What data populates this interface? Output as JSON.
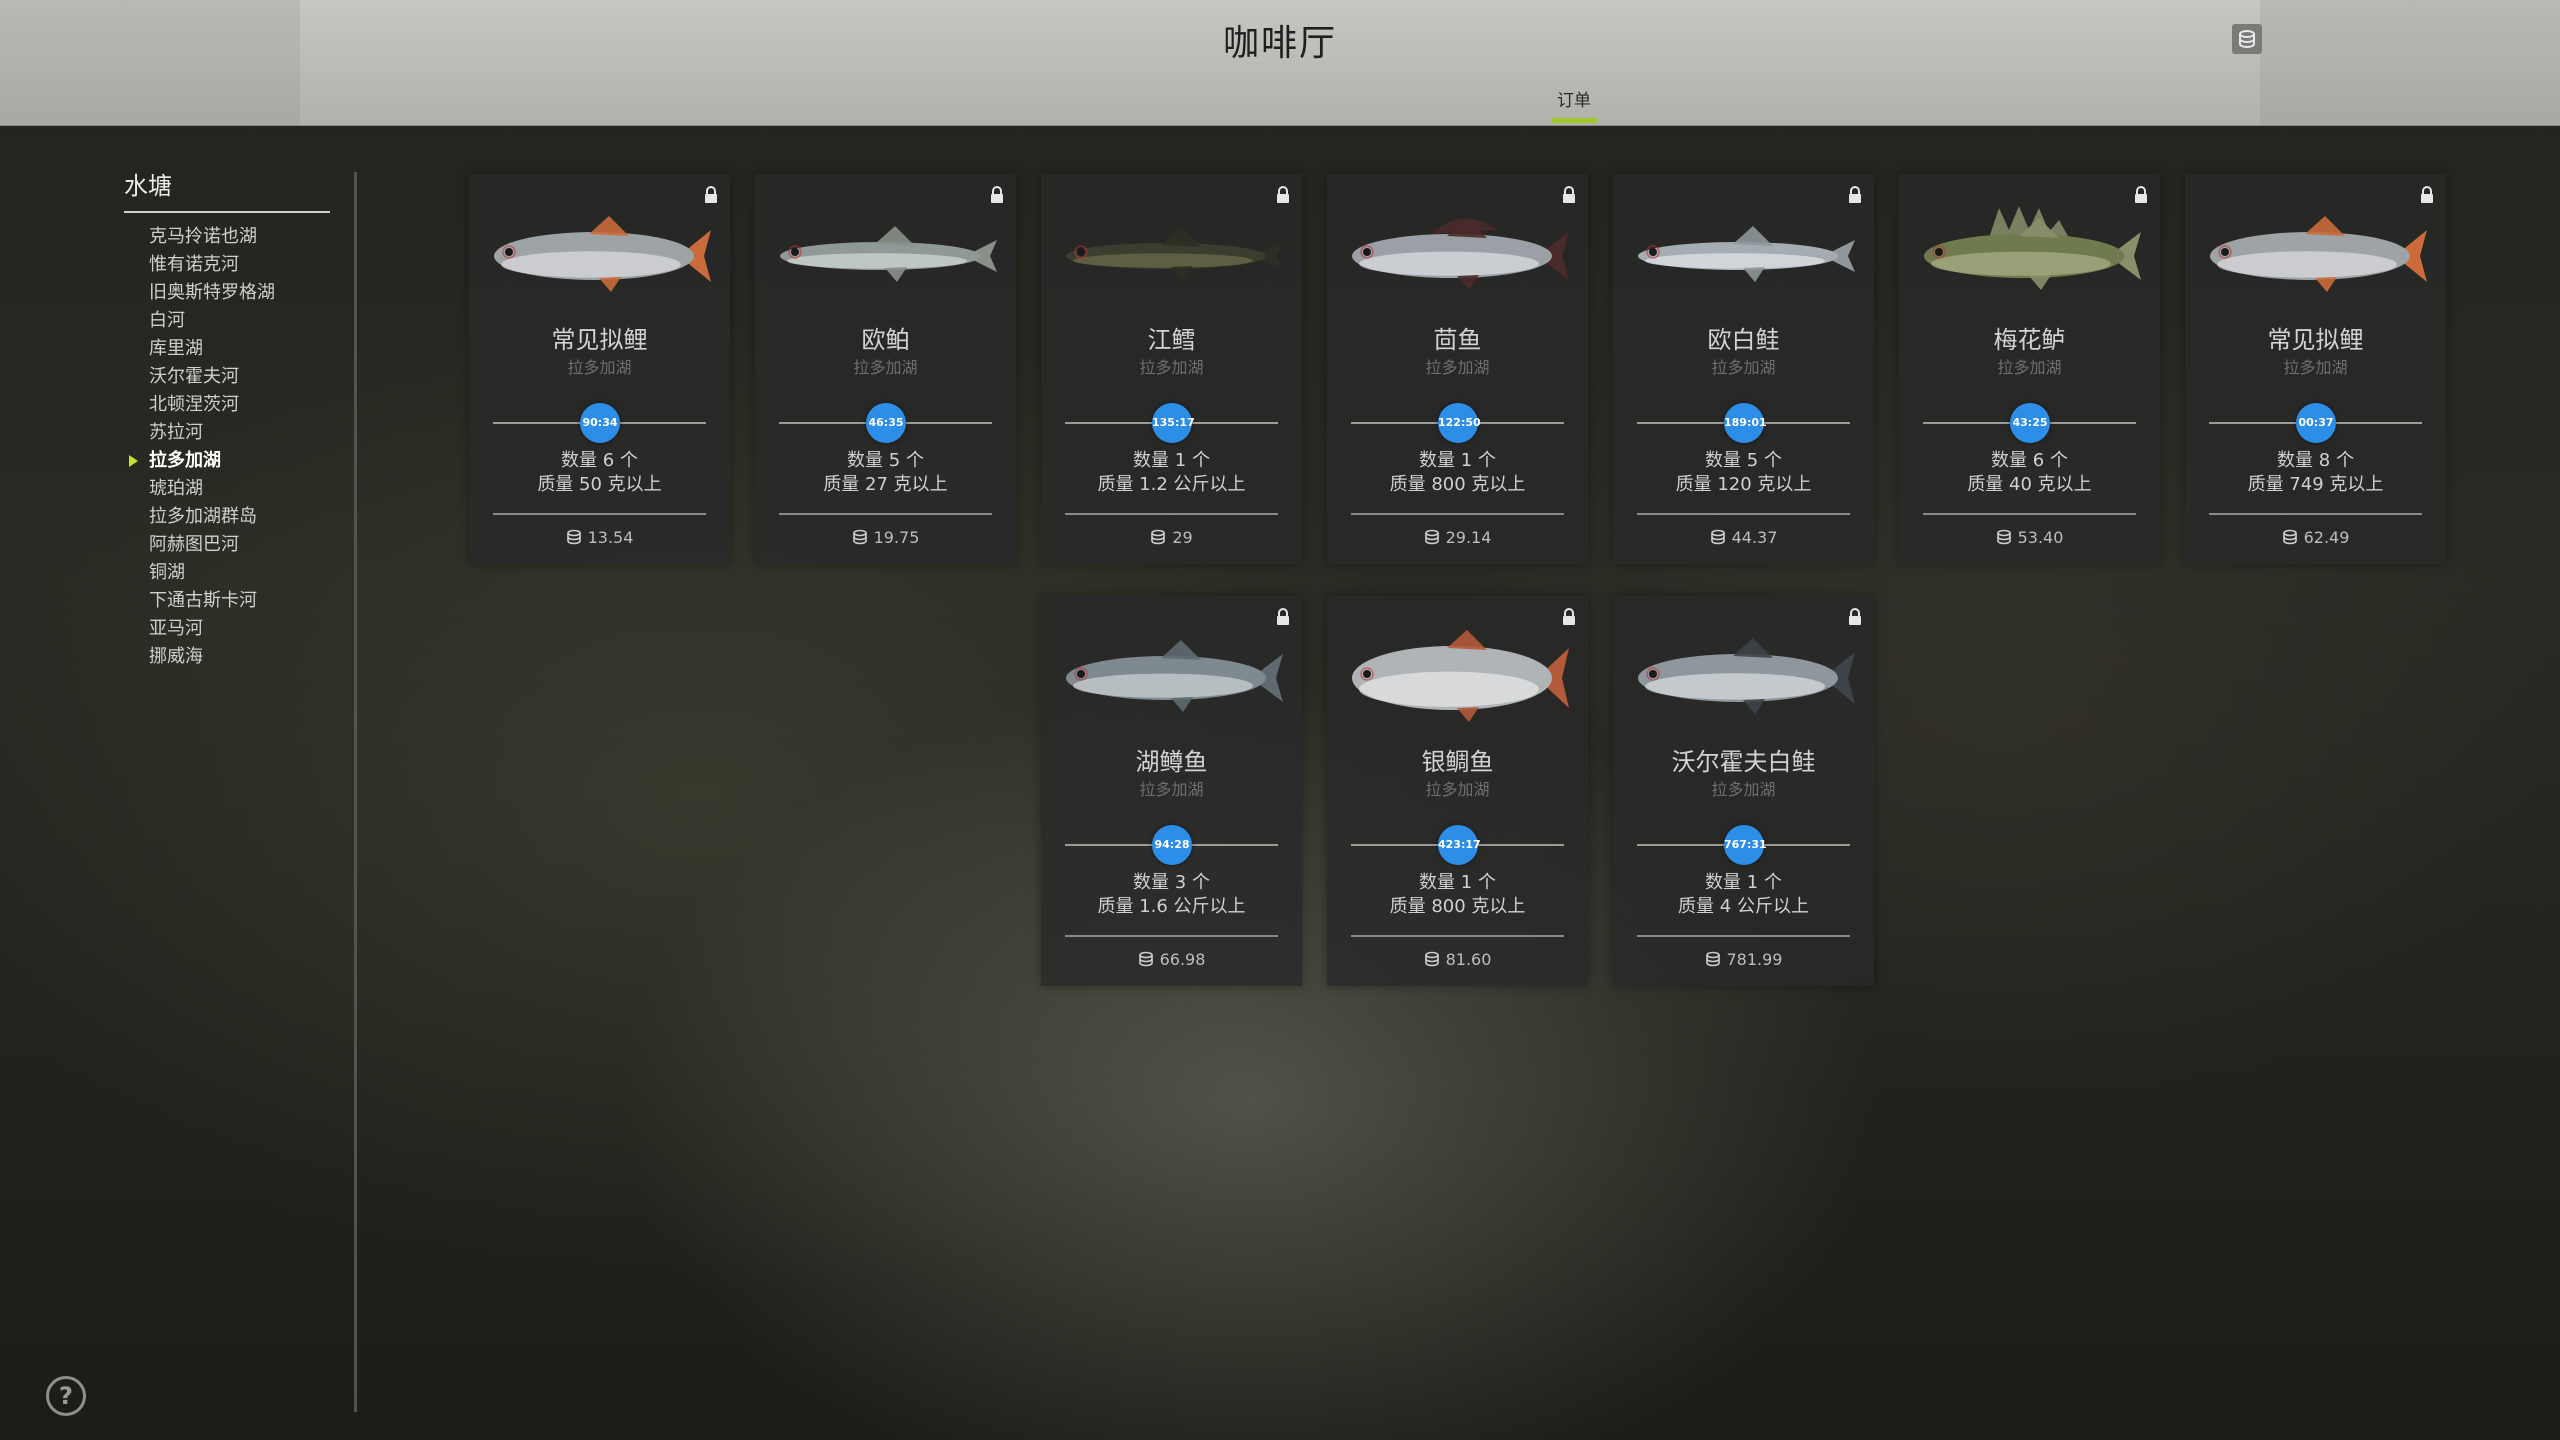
{
  "header": {
    "title": "咖啡厅",
    "tab_label": "订单"
  },
  "sidebar": {
    "title": "水塘",
    "items": [
      {
        "label": "克马拎诺也湖",
        "active": false
      },
      {
        "label": "惟有诺克河",
        "active": false
      },
      {
        "label": "旧奥斯特罗格湖",
        "active": false
      },
      {
        "label": "白河",
        "active": false
      },
      {
        "label": "库里湖",
        "active": false
      },
      {
        "label": "沃尔霍夫河",
        "active": false
      },
      {
        "label": "北顿涅茨河",
        "active": false
      },
      {
        "label": "苏拉河",
        "active": false
      },
      {
        "label": "拉多加湖",
        "active": true
      },
      {
        "label": "琥珀湖",
        "active": false
      },
      {
        "label": "拉多加湖群岛",
        "active": false
      },
      {
        "label": "阿赫图巴河",
        "active": false
      },
      {
        "label": "铜湖",
        "active": false
      },
      {
        "label": "下通古斯卡河",
        "active": false
      },
      {
        "label": "亚马河",
        "active": false
      },
      {
        "label": "挪威海",
        "active": false
      }
    ]
  },
  "orders": [
    {
      "fish": "常见拟鲤",
      "location": "拉多加湖",
      "timer": "90:34",
      "quantity": "数量 6 个",
      "weight": "质量 50 克以上",
      "reward": "13.54",
      "fish_icon": "roach-fish-icon"
    },
    {
      "fish": "欧鲌",
      "location": "拉多加湖",
      "timer": "46:35",
      "quantity": "数量 5 个",
      "weight": "质量 27 克以上",
      "reward": "19.75",
      "fish_icon": "bleak-fish-icon"
    },
    {
      "fish": "江鳕",
      "location": "拉多加湖",
      "timer": "135:17",
      "quantity": "数量 1 个",
      "weight": "质量 1.2 公斤以上",
      "reward": "29",
      "fish_icon": "burbot-fish-icon"
    },
    {
      "fish": "茴鱼",
      "location": "拉多加湖",
      "timer": "122:50",
      "quantity": "数量 1 个",
      "weight": "质量 800 克以上",
      "reward": "29.14",
      "fish_icon": "grayling-fish-icon"
    },
    {
      "fish": "欧白鲑",
      "location": "拉多加湖",
      "timer": "189:01",
      "quantity": "数量 5 个",
      "weight": "质量 120 克以上",
      "reward": "44.37",
      "fish_icon": "vendace-fish-icon"
    },
    {
      "fish": "梅花鲈",
      "location": "拉多加湖",
      "timer": "43:25",
      "quantity": "数量 6 个",
      "weight": "质量 40 克以上",
      "reward": "53.40",
      "fish_icon": "ruffe-fish-icon"
    },
    {
      "fish": "常见拟鲤",
      "location": "拉多加湖",
      "timer": "00:37",
      "quantity": "数量 8 个",
      "weight": "质量 749 克以上",
      "reward": "62.49",
      "fish_icon": "roach-fish-icon"
    },
    {
      "fish": "湖鳟鱼",
      "location": "拉多加湖",
      "timer": "94:28",
      "quantity": "数量 3 个",
      "weight": "质量 1.6 公斤以上",
      "reward": "66.98",
      "fish_icon": "lake-trout-fish-icon"
    },
    {
      "fish": "银鲷鱼",
      "location": "拉多加湖",
      "timer": "423:17",
      "quantity": "数量 1 个",
      "weight": "质量 800 克以上",
      "reward": "81.60",
      "fish_icon": "silver-bream-fish-icon"
    },
    {
      "fish": "沃尔霍夫白鲑",
      "location": "拉多加湖",
      "timer": "767:31",
      "quantity": "数量 1 个",
      "weight": "质量 4 公斤以上",
      "reward": "781.99",
      "fish_icon": "volkhov-whitefish-fish-icon"
    }
  ],
  "colors": {
    "accent": "#9ec72a",
    "timer": "#2d8ee8",
    "active_arrow": "#c7e02c"
  }
}
